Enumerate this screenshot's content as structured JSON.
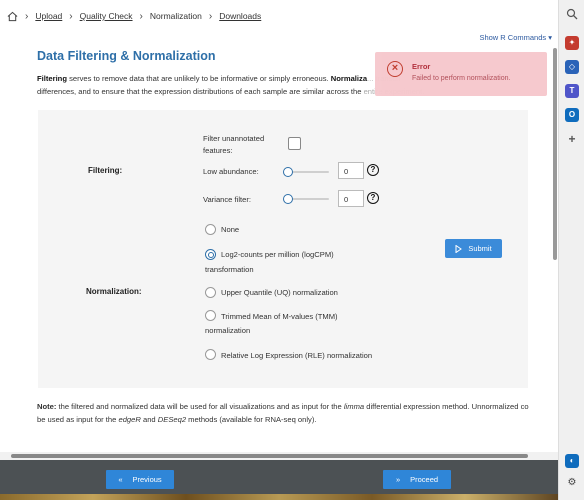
{
  "breadcrumb": {
    "items": [
      "Upload",
      "Quality Check",
      "Normalization",
      "Downloads"
    ]
  },
  "show_r_commands": "Show R Commands",
  "page_title": "Data Filtering & Normalization",
  "intro": {
    "filtering_word": "Filtering",
    "text1": " serves to remove data that are unlikely to be informative or simply erroneous. ",
    "normalization_word": "Normaliza",
    "text2_faded": "... transcri",
    "line2": "differences, and to ensure that the expression distributions of each sample are similar across the",
    "line2_faded": " entire experiment."
  },
  "filtering": {
    "section_label": "Filtering:",
    "unannotated_label_1": "Filter unannotated",
    "unannotated_label_2": "features:",
    "low_abundance_label": "Low abundance:",
    "low_abundance_value": "0",
    "variance_label": "Variance filter:",
    "variance_value": "0",
    "low_abundance_level": 0,
    "variance_level": 0,
    "help_glyph": "?"
  },
  "normalization": {
    "section_label": "Normalization:",
    "options": [
      {
        "label": "None",
        "label2": "",
        "selected": false
      },
      {
        "label": "Log2-counts per million (logCPM)",
        "label2": "transformation",
        "selected": true
      },
      {
        "label": "Upper Quantile (UQ) normalization",
        "label2": "",
        "selected": false
      },
      {
        "label": "Trimmed Mean of M-values (TMM)",
        "label2": "normalization",
        "selected": false
      },
      {
        "label": "Relative Log Expression (RLE) normalization",
        "label2": "",
        "selected": false
      }
    ]
  },
  "submit_label": "Submit",
  "note": {
    "bold": "Note:",
    "line1_a": " the filtered and normalized data will be used for all visualizations and as input for the ",
    "limma": "limma",
    "line1_b": " differential expression method. Unnormalized co",
    "line2_a": "be used as input for the ",
    "edger": "edgeR",
    "line2_b": " and ",
    "deseq2": "DESeq2",
    "line2_c": " methods (available for RNA-seq only)."
  },
  "footer": {
    "previous_label": "Previous",
    "proceed_label": "Proceed"
  },
  "toast": {
    "title": "Error",
    "message": "Failed to perform normalization."
  },
  "colors": {
    "accent": "#2e6fa8",
    "button": "#2f86d8",
    "error": "#b02a37",
    "footer_bg": "#4c5154"
  }
}
